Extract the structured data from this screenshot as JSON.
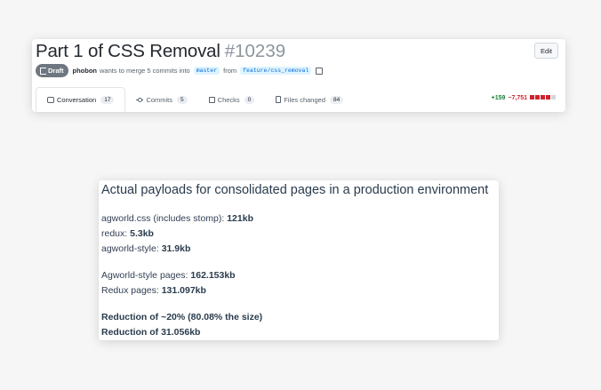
{
  "pr": {
    "title": "Part 1 of CSS Removal",
    "number": "#10239",
    "edit_label": "Edit",
    "draft_label": "Draft",
    "author": "phobon",
    "merge_text": "wants to merge 5 commits into",
    "base_branch": "master",
    "from_text": "from",
    "head_branch": "feature/css_removal",
    "tabs": [
      {
        "label": "Conversation",
        "count": "17"
      },
      {
        "label": "Commits",
        "count": "5"
      },
      {
        "label": "Checks",
        "count": "0"
      },
      {
        "label": "Files changed",
        "count": "84"
      }
    ],
    "additions": "+159",
    "deletions": "−7,751",
    "diff_colors": [
      "#cf222e",
      "#cf222e",
      "#cf222e",
      "#cf222e",
      "#d0d7de"
    ]
  },
  "payload": {
    "title": "Actual payloads for consolidated pages in a production environment",
    "group1": [
      {
        "label": "agworld.css (includes stomp): ",
        "value": "121kb"
      },
      {
        "label": "redux: ",
        "value": "5.3kb"
      },
      {
        "label": "agworld-style: ",
        "value": "31.9kb"
      }
    ],
    "group2": [
      {
        "label": "Agworld-style pages: ",
        "value": "162.153kb"
      },
      {
        "label": "Redux pages: ",
        "value": "131.097kb"
      }
    ],
    "summary": [
      "Reduction of ~20% (80.08% the size)",
      "Reduction of 31.056kb"
    ]
  }
}
